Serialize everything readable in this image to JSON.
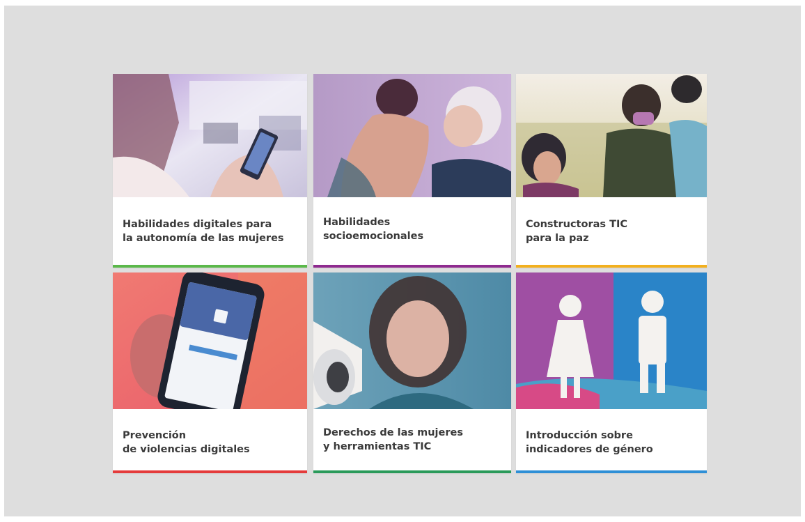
{
  "cards": [
    {
      "title": "Habilidades digitales para\nla autonomía de las mujeres",
      "accent": "#5bb84a",
      "image_icon": "woman-using-smartphone"
    },
    {
      "title": "Habilidades\nsocioemocionales",
      "accent": "#8e2a8f",
      "image_icon": "women-embracing"
    },
    {
      "title": "Constructoras TIC\npara la paz",
      "accent": "#f2b01e",
      "image_icon": "community-group"
    },
    {
      "title": "Prevención\nde violencias digitales",
      "accent": "#e43b3b",
      "image_icon": "smartphone-social-media"
    },
    {
      "title": "Derechos de las mujeres\ny herramientas TIC",
      "accent": "#2a9a5a",
      "image_icon": "woman-megaphone"
    },
    {
      "title": "Introducción sobre\nindicadores de género",
      "accent": "#2e8fd6",
      "image_icon": "gender-figures"
    }
  ]
}
